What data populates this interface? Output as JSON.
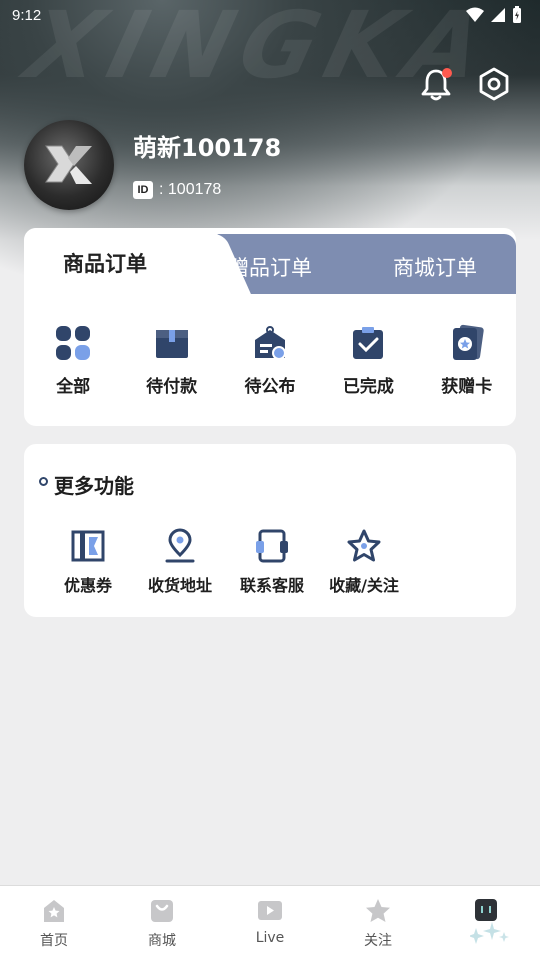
{
  "status_bar": {
    "time": "9:12"
  },
  "hero": {
    "watermark": "XINGKA"
  },
  "profile": {
    "username": "萌新100178",
    "id_badge": "ID",
    "id_value": ": 100178"
  },
  "order_tabs": [
    {
      "label": "商品订单",
      "active": true
    },
    {
      "label": "赠品订单",
      "active": false
    },
    {
      "label": "商城订单",
      "active": false
    }
  ],
  "order_items": [
    {
      "label": "全部",
      "icon": "grid-icon"
    },
    {
      "label": "待付款",
      "icon": "wallet-icon"
    },
    {
      "label": "待公布",
      "icon": "pending-icon"
    },
    {
      "label": "已完成",
      "icon": "check-icon"
    },
    {
      "label": "获赠卡",
      "icon": "card-icon"
    }
  ],
  "more": {
    "title": "更多功能",
    "items": [
      {
        "label": "优惠券",
        "icon": "coupon-icon"
      },
      {
        "label": "收货地址",
        "icon": "location-icon"
      },
      {
        "label": "联系客服",
        "icon": "customer-service-icon"
      },
      {
        "label": "收藏/关注",
        "icon": "star-icon"
      }
    ]
  },
  "bottom_nav": [
    {
      "label": "首页",
      "icon": "home-icon"
    },
    {
      "label": "商城",
      "icon": "bag-icon"
    },
    {
      "label": "Live",
      "icon": "play-icon"
    },
    {
      "label": "关注",
      "icon": "star-icon"
    },
    {
      "label": "",
      "icon": "profile-icon"
    }
  ],
  "colors": {
    "accent": "#7e8db1",
    "icon_dark": "#30456a",
    "notice_dot": "#ff5a4f"
  }
}
